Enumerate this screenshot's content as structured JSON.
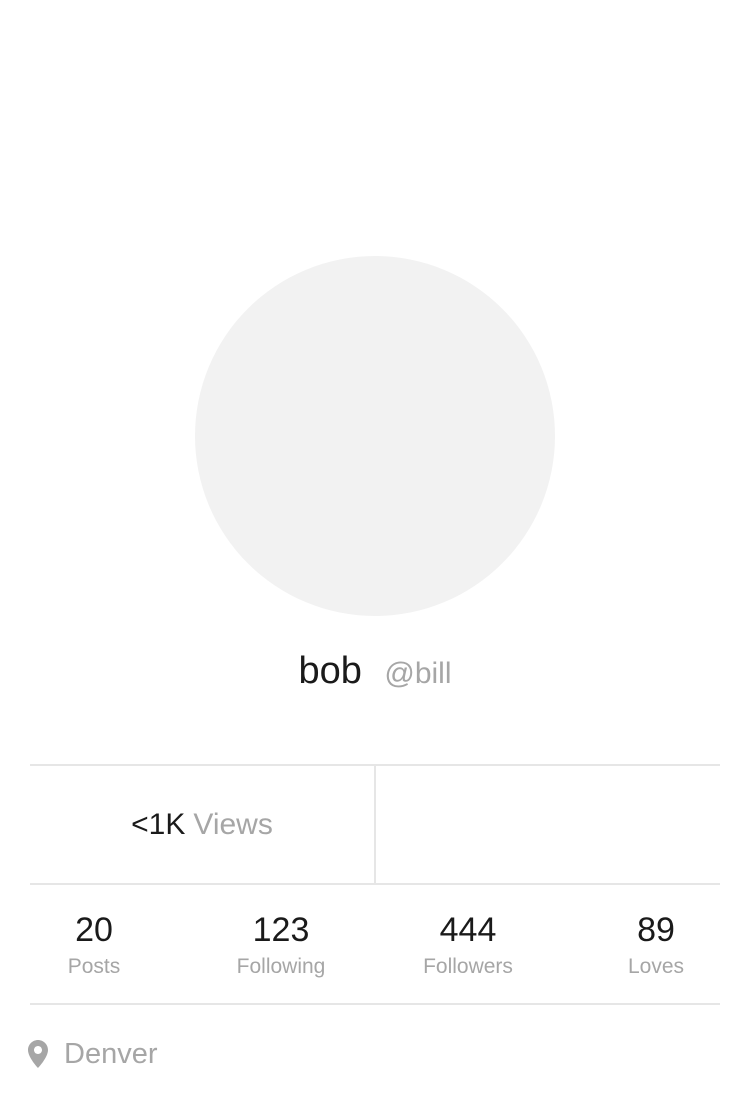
{
  "profile": {
    "display_name": "bob",
    "handle": "@bill",
    "avatar_color": "#f2f2f2"
  },
  "views": {
    "count": "<1K",
    "label": "Views"
  },
  "stats": [
    {
      "value": "20",
      "label": "Posts"
    },
    {
      "value": "123",
      "label": "Following"
    },
    {
      "value": "444",
      "label": "Followers"
    },
    {
      "value": "89",
      "label": "Loves"
    }
  ],
  "location": {
    "icon": "location-pin-icon",
    "text": "Denver"
  },
  "colors": {
    "primary_text": "#1a1a1a",
    "secondary_text": "#a6a6a6",
    "divider": "#e6e6e6"
  }
}
